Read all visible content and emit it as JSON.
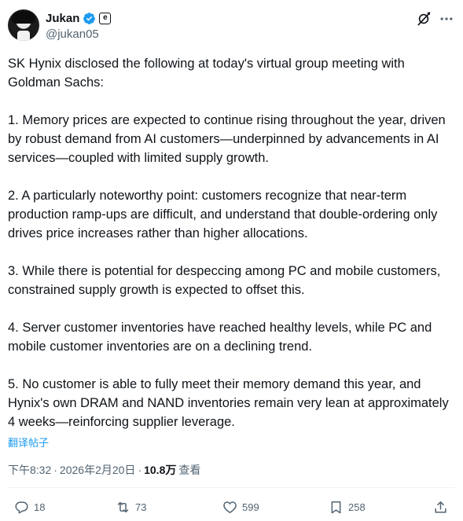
{
  "author": {
    "display_name": "Jukan",
    "handle": "@jukan05",
    "affiliate_badge": "e"
  },
  "icons": {
    "verified": "verified-badge-icon",
    "grok": "grok-icon",
    "more": "more-icon",
    "reply": "reply-icon",
    "retweet": "retweet-icon",
    "like": "like-icon",
    "bookmark": "bookmark-icon",
    "share": "share-icon"
  },
  "colors": {
    "accent": "#1d9bf0",
    "text": "#0f1419",
    "muted": "#536471"
  },
  "post": {
    "paragraphs": [
      "SK Hynix disclosed the following at today's virtual group meeting with Goldman Sachs:",
      "1. Memory prices are expected to continue rising throughout the year, driven by robust demand from AI customers—underpinned by advancements in AI services—coupled with limited supply growth.",
      "2. A particularly noteworthy point: customers recognize that near-term production ramp-ups are difficult, and understand that double-ordering only drives price increases rather than higher allocations.",
      "3. While there is potential for despeccing among PC and mobile customers, constrained supply growth is expected to offset this.",
      "4. Server customer inventories have reached healthy levels, while PC and mobile customer inventories are on a declining trend.",
      "5. No customer is able to fully meet their memory demand this year, and Hynix's own DRAM and NAND inventories remain very lean at approximately 4 weeks—reinforcing supplier leverage."
    ],
    "translate_label": "翻译帖子",
    "time": "下午8:32",
    "separator": "·",
    "date": "2026年2月20日",
    "views_count": "10.8万",
    "views_label": "查看"
  },
  "actions": {
    "replies": "18",
    "retweets": "73",
    "likes": "599",
    "bookmarks": "258"
  }
}
